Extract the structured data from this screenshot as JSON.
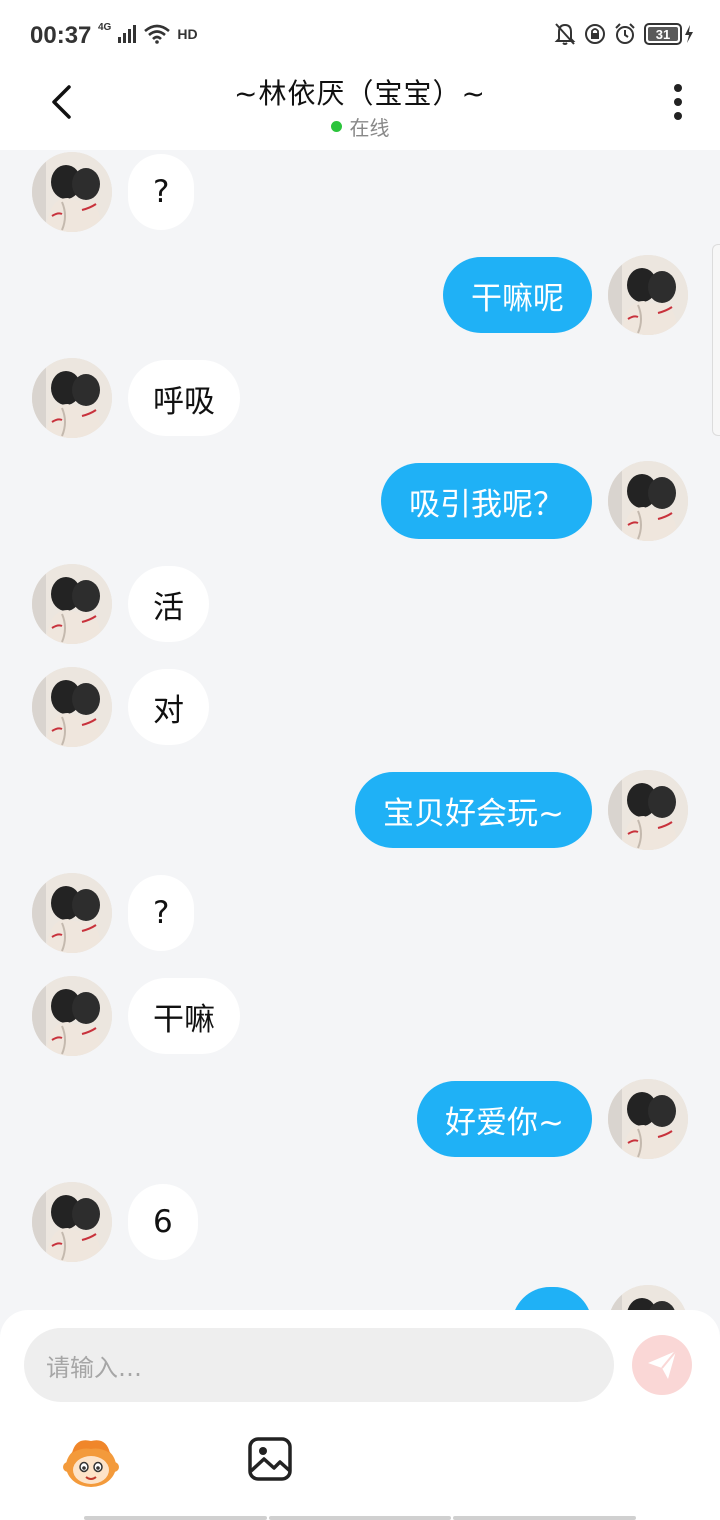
{
  "status_bar": {
    "time": "00:37",
    "network": "4G",
    "hd": "HD",
    "battery": "31",
    "icons": [
      "signal-icon",
      "wifi-icon",
      "hd-icon",
      "mute-bell-icon",
      "rotation-lock-icon",
      "alarm-icon",
      "battery-icon",
      "charging-icon"
    ]
  },
  "header": {
    "title": "~林依厌（宝宝）~",
    "status": "在线",
    "status_color": "#2bc43c"
  },
  "messages": [
    {
      "side": "left",
      "text": "?"
    },
    {
      "side": "right",
      "text": "干嘛呢"
    },
    {
      "side": "left",
      "text": "呼吸"
    },
    {
      "side": "right",
      "text": "吸引我呢？"
    },
    {
      "side": "left",
      "text": "活"
    },
    {
      "side": "left",
      "text": "对"
    },
    {
      "side": "right",
      "text": "宝贝好会玩~"
    },
    {
      "side": "left",
      "text": "?"
    },
    {
      "side": "left",
      "text": "干嘛"
    },
    {
      "side": "right",
      "text": "好爱你~"
    },
    {
      "side": "left",
      "text": "6"
    },
    {
      "side": "right",
      "text": ""
    }
  ],
  "composer": {
    "placeholder": "请输入…",
    "send_color": "#fad7d6",
    "tools": [
      "emoji-mascot-icon",
      "image-icon"
    ]
  },
  "colors": {
    "outgoing_bubble": "#1fb1f6",
    "incoming_bubble": "#ffffff",
    "chat_background": "#f4f5f7"
  }
}
